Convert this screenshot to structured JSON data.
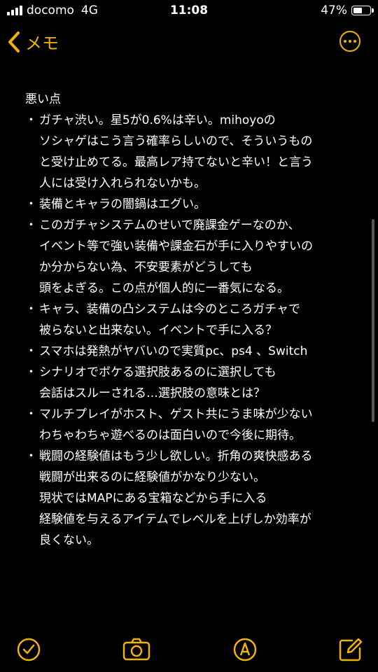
{
  "status_bar": {
    "carrier": "docomo",
    "network": "4G",
    "time": "11:08",
    "battery": "47%"
  },
  "nav": {
    "back_label": "メモ",
    "accent_color": "#f0b400"
  },
  "note": {
    "heading": "悪い点",
    "bullets": [
      [
        "ガチャ渋い。星5が0.6%は辛い。mihoyoの",
        "ソシャゲはこう言う確率らしいので、そういうもの",
        "と受け止めてる。最高レア持てないと辛い！と言う",
        "人には受け入れられないかも。"
      ],
      [
        "装備とキャラの闇鍋はエグい。"
      ],
      [
        "このガチャシステムのせいで廃課金ゲーなのか、",
        "イベント等で強い装備や課金石が手に入りやすいの",
        "か分からない為、不安要素がどうしても",
        "頭をよぎる。この点が個人的に一番気になる。"
      ],
      [
        "キャラ、装備の凸システムは今のところガチャで",
        "被らないと出来ない。イベントで手に入る？"
      ],
      [
        "スマホは発熱がヤバいので実質pc、ps4 、Switch"
      ],
      [
        "シナリオでボケる選択肢あるのに選択しても",
        "会話はスルーされる…選択肢の意味とは？"
      ],
      [
        "マルチプレイがホスト、ゲスト共にうま味が少ない",
        "わちゃわちゃ遊べるのは面白いので今後に期待。"
      ],
      [
        "戦闘の経験値はもう少し欲しい。折角の爽快感ある",
        "戦闘が出来るのに経験値がかなり少ない。",
        "現状ではMAPにある宝箱などから手に入る",
        "経験値を与えるアイテムでレベルを上げしか効率が",
        "良くない。"
      ]
    ],
    "bullet_mark": "・"
  },
  "toolbar": {
    "icons": [
      "checklist-icon",
      "camera-icon",
      "markup-icon",
      "compose-icon"
    ]
  }
}
